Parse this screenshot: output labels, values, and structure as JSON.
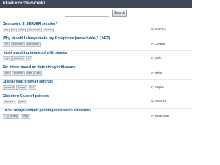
{
  "header": {
    "title": "Stackoverflow.mobi"
  },
  "search": {
    "placeholder": "",
    "value": "",
    "button_label": "Search"
  },
  "questions": [
    {
      "title": "Destroying $_SERVER session?",
      "tags": [
        "php",
        "ssl",
        "https",
        "php-mcrypt",
        "session"
      ],
      "author": "by TaaCasi"
    },
    {
      "title": "Why should I always make my Exceptions [serializable]? (.NET)",
      "tags": [
        ".net",
        "exceptions",
        "serialization"
      ],
      "author": "by Cheeso"
    },
    {
      "title": "regex matching image url with spaces",
      "tags": [
        "regex",
        "javascript",
        "url"
      ],
      "author": "by Mark"
    },
    {
      "title": "Set mtime based on date string in filename",
      "tags": [
        "bash",
        "filenames",
        "date",
        "unix"
      ],
      "author": "by Miles"
    },
    {
      "title": "Display web browser settings",
      "tags": [
        "javascript",
        "browser",
        "html"
      ],
      "author": "by magius"
    },
    {
      "title": "Objective C use of pointers",
      "tags": [
        "objective-c",
        "iphone"
      ],
      "author": "by Davidad"
    },
    {
      "title": "Can C arrays contain padding in between elements?",
      "tags": [
        "c",
        "padding",
        "arrays"
      ],
      "author": "by wintermute"
    }
  ]
}
